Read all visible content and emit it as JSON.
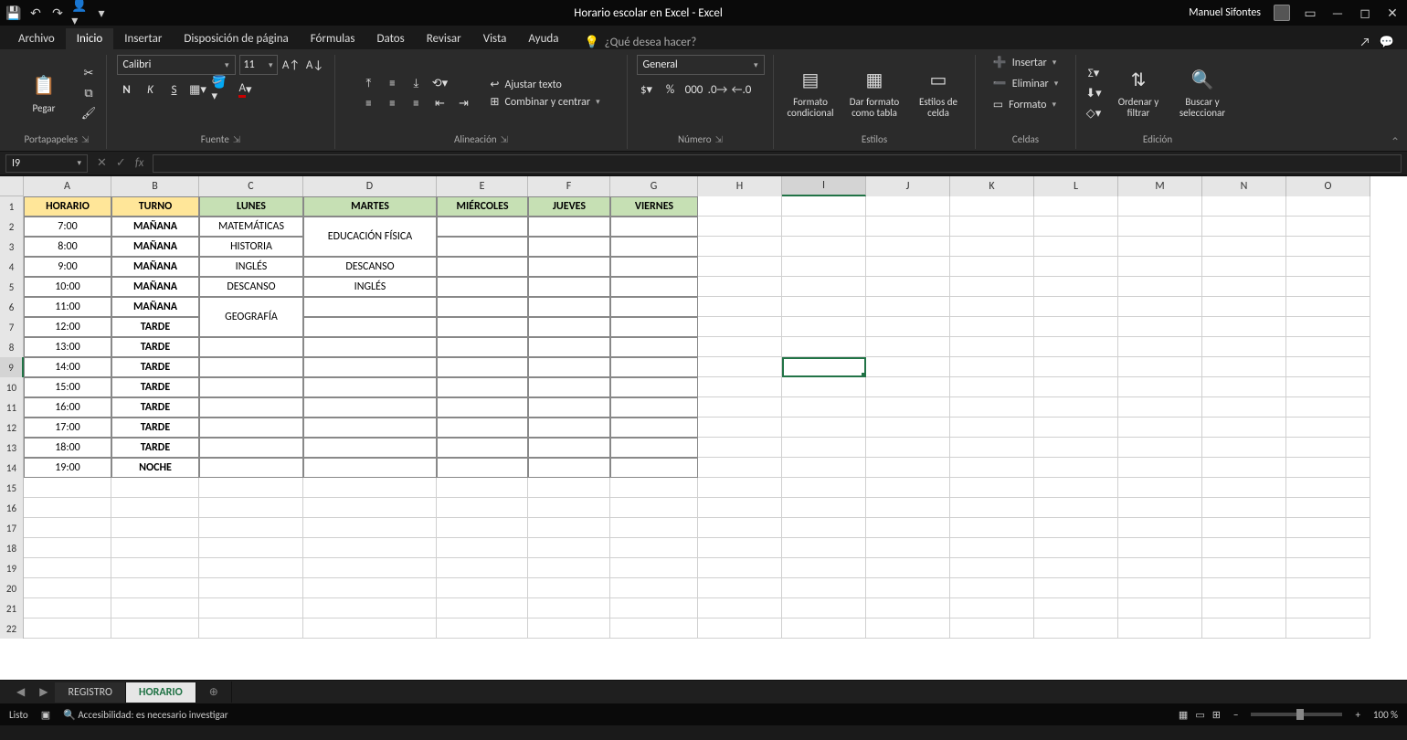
{
  "title": "Horario escolar en Excel  -  Excel",
  "user": "Manuel Sifontes",
  "tabs": [
    "Archivo",
    "Inicio",
    "Insertar",
    "Disposición de página",
    "Fórmulas",
    "Datos",
    "Revisar",
    "Vista",
    "Ayuda"
  ],
  "active_tab": "Inicio",
  "tellme": "¿Qué desea hacer?",
  "ribbon": {
    "clipboard": {
      "paste": "Pegar",
      "label": "Portapapeles"
    },
    "font": {
      "name": "Calibri",
      "size": "11",
      "label": "Fuente",
      "bold": "N",
      "italic": "K",
      "underline": "S"
    },
    "align": {
      "wrap": "Ajustar texto",
      "merge": "Combinar y centrar",
      "label": "Alineación"
    },
    "number": {
      "format": "General",
      "label": "Número"
    },
    "styles": {
      "cond": "Formato condicional",
      "table": "Dar formato como tabla",
      "cell": "Estilos de celda",
      "label": "Estilos"
    },
    "cells": {
      "insert": "Insertar",
      "delete": "Eliminar",
      "format": "Formato",
      "label": "Celdas"
    },
    "editing": {
      "sort": "Ordenar y filtrar",
      "find": "Buscar y seleccionar",
      "label": "Edición"
    }
  },
  "namebox": "I9",
  "columns": [
    "A",
    "B",
    "C",
    "D",
    "E",
    "F",
    "G",
    "H",
    "I",
    "J",
    "K",
    "L",
    "M",
    "N",
    "O"
  ],
  "schedule": {
    "headers": [
      "HORARIO",
      "TURNO",
      "LUNES",
      "MARTES",
      "MIÉRCOLES",
      "JUEVES",
      "VIERNES"
    ],
    "rows": [
      {
        "h": "7:00",
        "t": "MAÑANA",
        "c": "MATEMÁTICAS",
        "d": ""
      },
      {
        "h": "8:00",
        "t": "MAÑANA",
        "c": "HISTORIA",
        "d": "EDUCACIÓN FÍSICA",
        "d_merge_up": true
      },
      {
        "h": "9:00",
        "t": "MAÑANA",
        "c": "INGLÉS",
        "d": "DESCANSO"
      },
      {
        "h": "10:00",
        "t": "MAÑANA",
        "c": "DESCANSO",
        "d": "INGLÉS"
      },
      {
        "h": "11:00",
        "t": "MAÑANA",
        "c": "",
        "d": ""
      },
      {
        "h": "12:00",
        "t": "TARDE",
        "c": "GEOGRAFÍA",
        "c_merge_up": true,
        "d": ""
      },
      {
        "h": "13:00",
        "t": "TARDE",
        "c": "",
        "d": ""
      },
      {
        "h": "14:00",
        "t": "TARDE",
        "c": "",
        "d": ""
      },
      {
        "h": "15:00",
        "t": "TARDE",
        "c": "",
        "d": ""
      },
      {
        "h": "16:00",
        "t": "TARDE",
        "c": "",
        "d": ""
      },
      {
        "h": "17:00",
        "t": "TARDE",
        "c": "",
        "d": ""
      },
      {
        "h": "18:00",
        "t": "TARDE",
        "c": "",
        "d": ""
      },
      {
        "h": "19:00",
        "t": "NOCHE",
        "c": "",
        "d": ""
      }
    ],
    "merged": {
      "d_2_3": "EDUCACIÓN FÍSICA",
      "c_6_7": "GEOGRAFÍA"
    }
  },
  "sheet_tabs": [
    "REGISTRO",
    "HORARIO"
  ],
  "active_sheet": "HORARIO",
  "status": {
    "ready": "Listo",
    "access": "Accesibilidad: es necesario investigar",
    "zoom": "100 %"
  }
}
